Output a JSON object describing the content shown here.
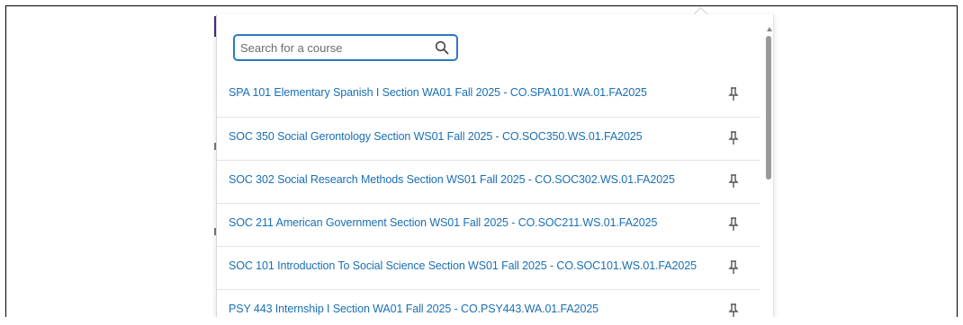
{
  "search": {
    "placeholder": "Search for a course",
    "value": ""
  },
  "icons": {
    "search": "search-icon",
    "pin": "pin-icon",
    "scroll_up": "chevron-up-icon"
  },
  "colors": {
    "link": "#1a6fb5",
    "focus_border": "#2b78c2",
    "accent_purple": "#4b2a7f"
  },
  "courses": [
    {
      "label": "SPA 101 Elementary Spanish I Section WA01 Fall 2025 - CO.SPA101.WA.01.FA2025"
    },
    {
      "label": "SOC 350 Social Gerontology Section WS01 Fall 2025 - CO.SOC350.WS.01.FA2025"
    },
    {
      "label": "SOC 302 Social Research Methods Section WS01 Fall 2025 - CO.SOC302.WS.01.FA2025"
    },
    {
      "label": "SOC 211 American Government Section WS01 Fall 2025 - CO.SOC211.WS.01.FA2025"
    },
    {
      "label": "SOC 101 Introduction To Social Science Section WS01 Fall 2025 - CO.SOC101.WS.01.FA2025"
    },
    {
      "label": "PSY 443 Internship I Section WA01 Fall 2025 - CO.PSY443.WA.01.FA2025"
    }
  ]
}
